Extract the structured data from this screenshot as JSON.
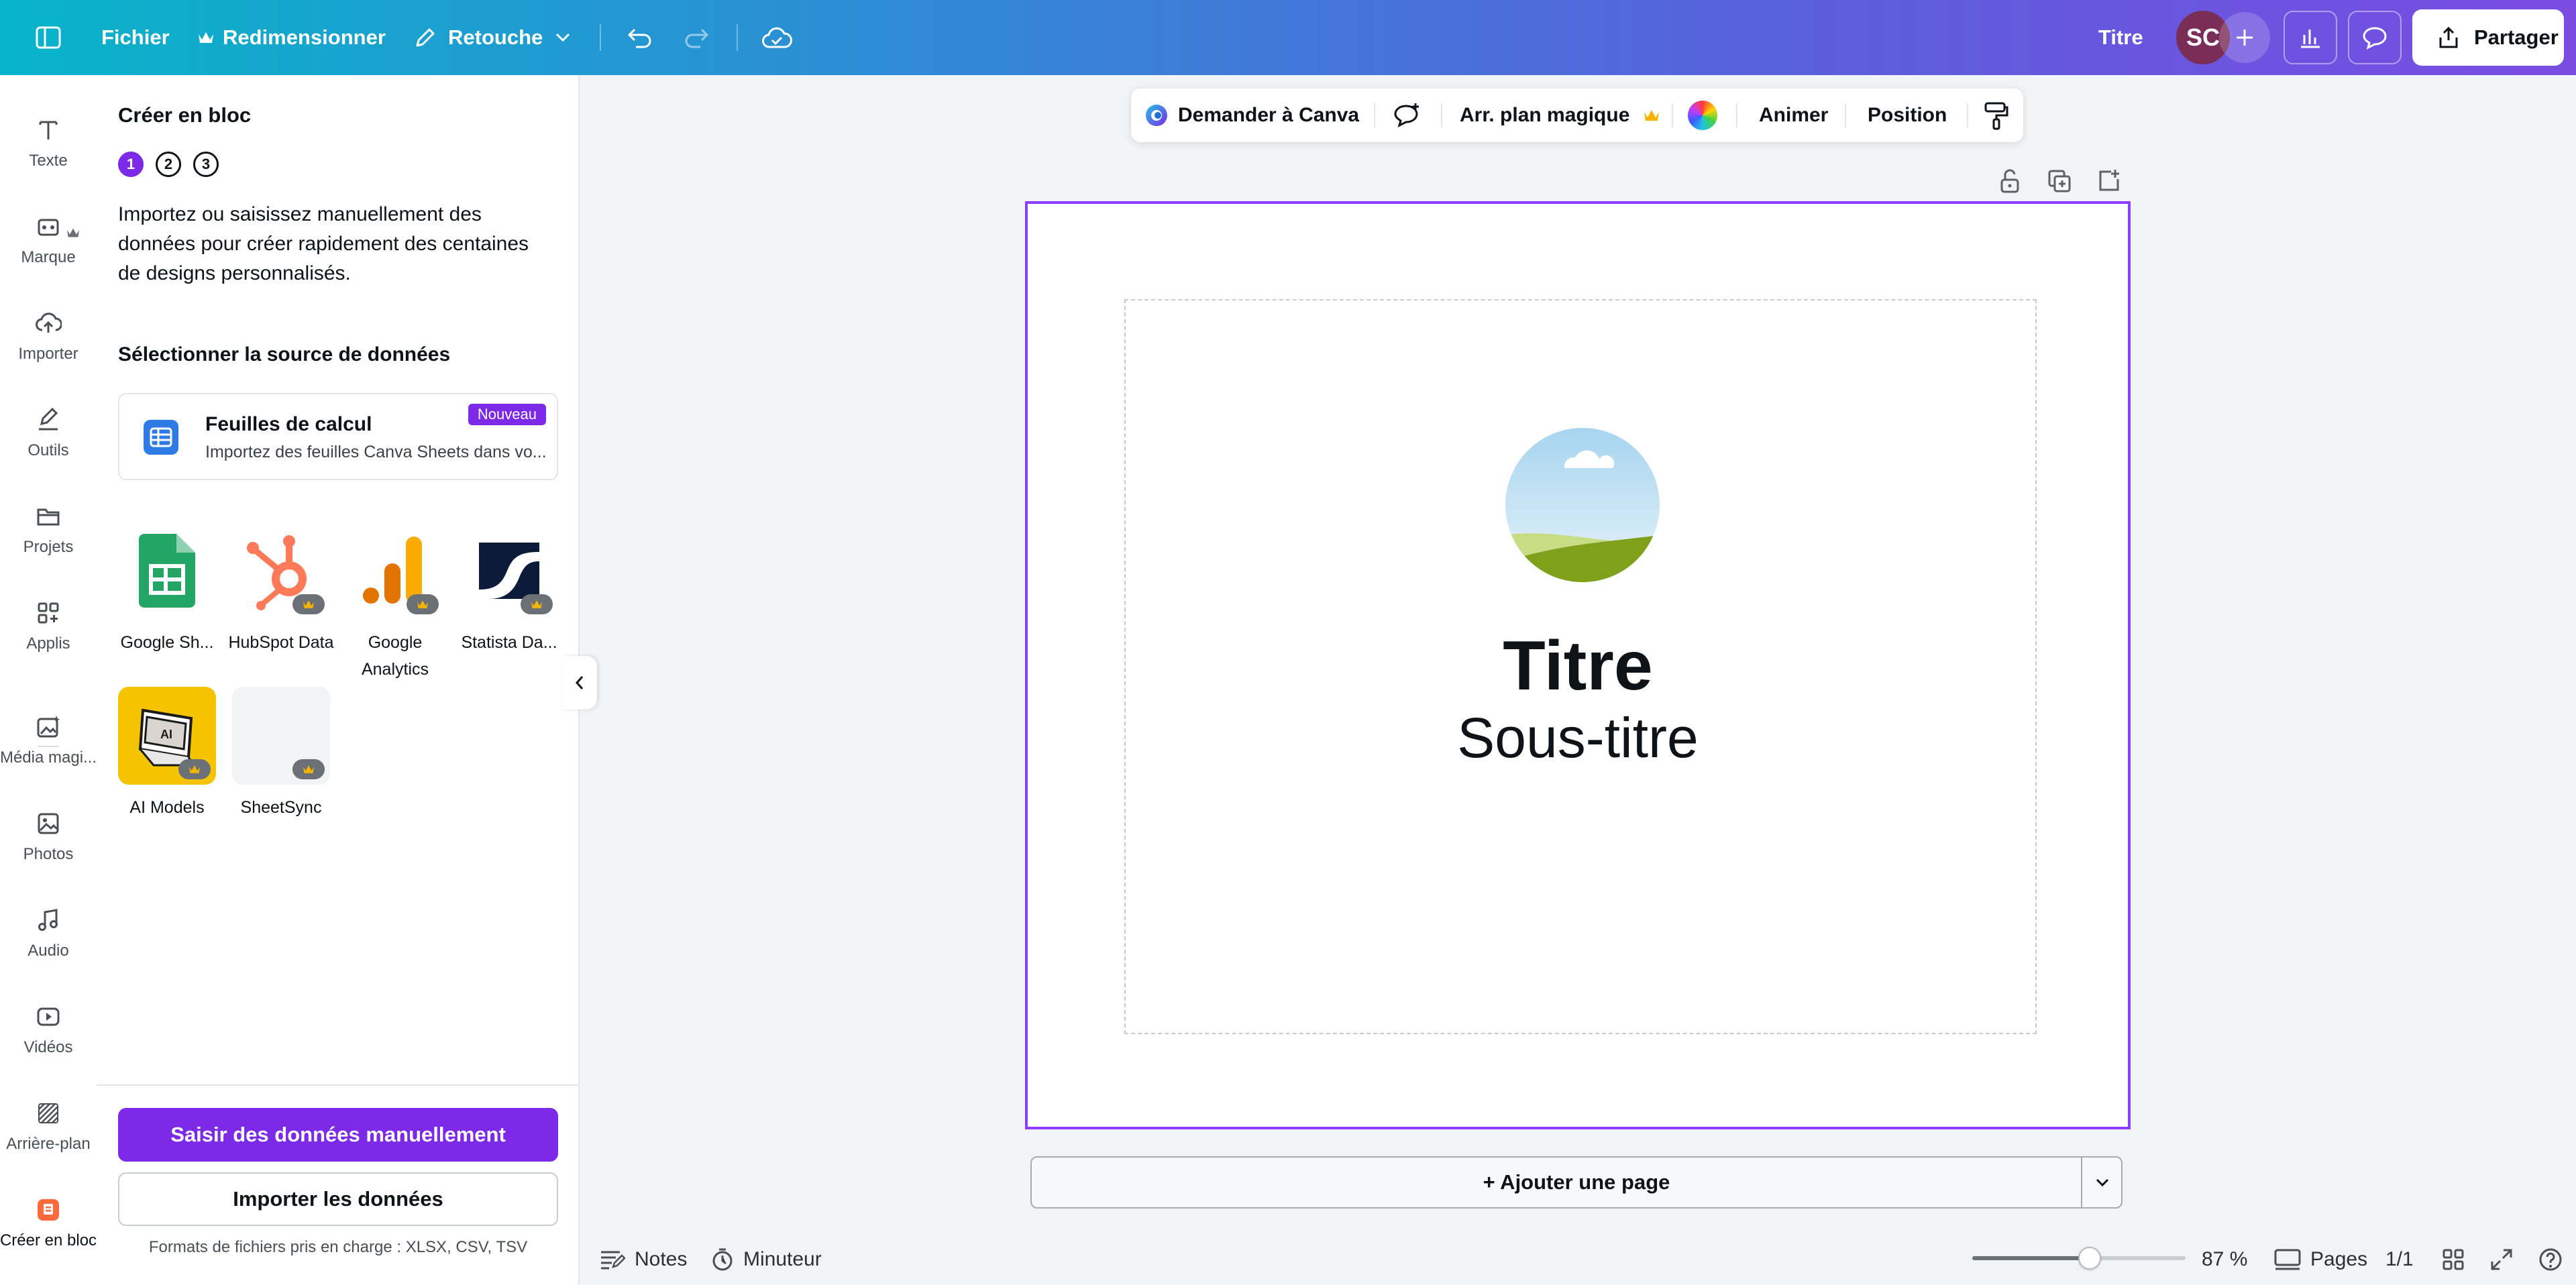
{
  "topbar": {
    "menu_icon": "sidebar-toggle-icon",
    "file": "Fichier",
    "resize": "Redimensionner",
    "edit_mode": "Retouche",
    "title": "Titre",
    "avatar": "SC",
    "share": "Partager"
  },
  "rail": {
    "items": [
      {
        "label": "Texte",
        "icon": "text-icon"
      },
      {
        "label": "Marque",
        "icon": "brand-icon"
      },
      {
        "label": "Importer",
        "icon": "upload-icon"
      },
      {
        "label": "Outils",
        "icon": "draw-icon"
      },
      {
        "label": "Projets",
        "icon": "folder-icon"
      },
      {
        "label": "Applis",
        "icon": "apps-icon"
      },
      {
        "label": "Média magi...",
        "icon": "magic-media-icon"
      },
      {
        "label": "Photos",
        "icon": "photos-icon"
      },
      {
        "label": "Audio",
        "icon": "audio-icon"
      },
      {
        "label": "Vidéos",
        "icon": "video-icon"
      },
      {
        "label": "Arrière-plan",
        "icon": "background-icon"
      },
      {
        "label": "Créer en bloc",
        "icon": "bulk-create-icon"
      }
    ]
  },
  "panel": {
    "title": "Créer en bloc",
    "steps": [
      "1",
      "2",
      "3"
    ],
    "description": "Importez ou saisissez manuellement des données pour créer rapidement des centaines de designs personnalisés.",
    "section_title": "Sélectionner la source de données",
    "sheet_card": {
      "title": "Feuilles de calcul",
      "subtitle": "Importez des feuilles Canva Sheets dans vo...",
      "badge": "Nouveau"
    },
    "apps": [
      {
        "label": "Google Sh...",
        "premium": false
      },
      {
        "label": "HubSpot Data",
        "premium": true
      },
      {
        "label": "Google Analytics",
        "premium": true
      },
      {
        "label": "Statista Da...",
        "premium": true
      },
      {
        "label": "AI Models",
        "premium": true
      },
      {
        "label": "SheetSync",
        "premium": true
      }
    ],
    "primary_button": "Saisir des données manuellement",
    "secondary_button": "Importer les données",
    "formats": "Formats de fichiers pris en charge : XLSX, CSV, TSV"
  },
  "context_toolbar": {
    "ask": "Demander à Canva",
    "magic_bg": "Arr. plan magique",
    "animate": "Animer",
    "position": "Position"
  },
  "canvas": {
    "title": "Titre",
    "subtitle": "Sous-titre",
    "add_page": "+ Ajouter une page"
  },
  "bottom": {
    "notes": "Notes",
    "timer": "Minuteur",
    "zoom": "87 %",
    "zoom_fraction": 0.55,
    "pages": "Pages",
    "page_count": "1/1"
  },
  "colors": {
    "accent": "#7d2ae8",
    "page_border": "#8b3dff",
    "topbar_start": "#08b4c9",
    "topbar_end": "#7a4ce2"
  }
}
